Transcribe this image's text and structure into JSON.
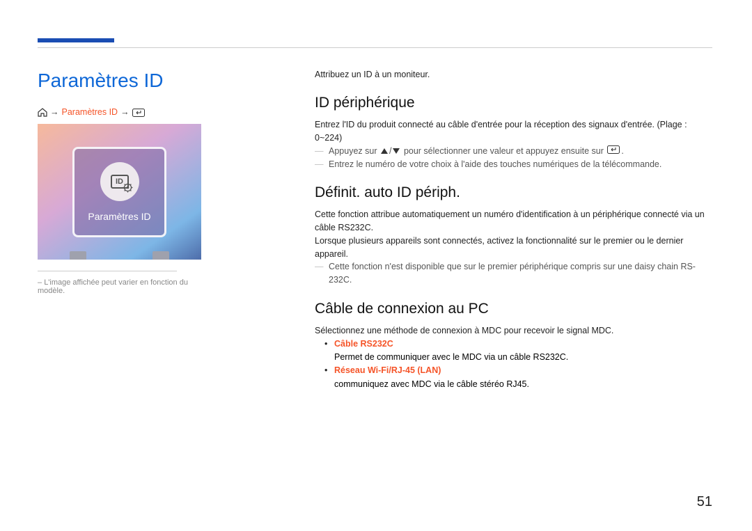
{
  "page_number": "51",
  "left": {
    "main_title": "Paramètres ID",
    "breadcrumb_label": "Paramètres ID",
    "illustration_id": "ID",
    "illustration_caption": "Paramètres ID",
    "footnote": "L'image affichée peut varier en fonction du modèle."
  },
  "right": {
    "intro": "Attribuez un ID à un moniteur.",
    "section1": {
      "title": "ID périphérique",
      "desc": "Entrez l'ID du produit connecté au câble d'entrée pour la réception des signaux d'entrée. (Plage : 0~224)",
      "note1_prefix": "Appuyez sur ",
      "note1_suffix": " pour sélectionner une valeur et appuyez ensuite sur ",
      "note1_end": ".",
      "note2": "Entrez le numéro de votre choix à l'aide des touches numériques de la télécommande."
    },
    "section2": {
      "title": "Définit. auto ID périph.",
      "desc": "Cette fonction attribue automatiquement un numéro d'identification à un périphérique connecté via un câble RS232C.",
      "desc2": "Lorsque plusieurs appareils sont connectés, activez la fonctionnalité sur le premier ou le dernier appareil.",
      "note1": "Cette fonction n'est disponible que sur le premier périphérique compris sur une daisy chain RS-232C."
    },
    "section3": {
      "title": "Câble de connexion au PC",
      "desc": "Sélectionnez une méthode de connexion à MDC pour recevoir le signal MDC.",
      "item1_label": "Câble RS232C",
      "item1_desc": "Permet de communiquer avec le MDC via un câble RS232C.",
      "item2_label": "Réseau Wi-Fi/RJ-45 (LAN)",
      "item2_desc": "communiquez avec MDC via le câble stéréo RJ45."
    }
  }
}
